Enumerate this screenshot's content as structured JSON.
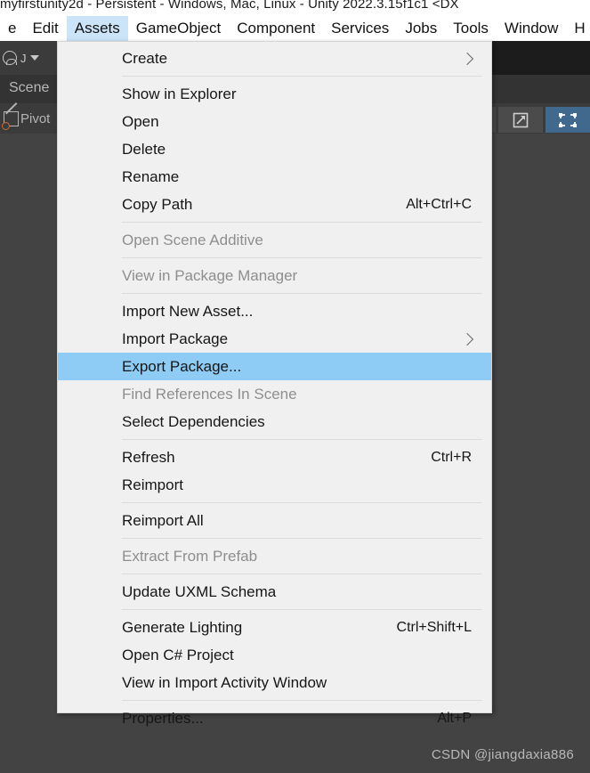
{
  "window": {
    "title": "myfirstunity2d - Persistent - Windows, Mac, Linux - Unity 2022.3.15f1c1 <DX"
  },
  "menubar": {
    "items": [
      {
        "label": "e",
        "active": false
      },
      {
        "label": "Edit",
        "active": false
      },
      {
        "label": "Assets",
        "active": true
      },
      {
        "label": "GameObject",
        "active": false
      },
      {
        "label": "Component",
        "active": false
      },
      {
        "label": "Services",
        "active": false
      },
      {
        "label": "Jobs",
        "active": false
      },
      {
        "label": "Tools",
        "active": false
      },
      {
        "label": "Window",
        "active": false
      },
      {
        "label": "H",
        "active": false
      }
    ]
  },
  "editor": {
    "account_label": "J",
    "scene_tab": "Scene",
    "pivot_label": "Pivot",
    "tools": [
      {
        "name": "rotate-tool",
        "selected": false
      },
      {
        "name": "scale-tool",
        "selected": false
      },
      {
        "name": "rect-transform-tool",
        "selected": true
      }
    ]
  },
  "assets_menu": {
    "entries": [
      {
        "type": "item",
        "label": "Create",
        "shortcut": "",
        "submenu": true,
        "disabled": false,
        "highlight": false
      },
      {
        "type": "separator"
      },
      {
        "type": "item",
        "label": "Show in Explorer",
        "shortcut": "",
        "submenu": false,
        "disabled": false,
        "highlight": false
      },
      {
        "type": "item",
        "label": "Open",
        "shortcut": "",
        "submenu": false,
        "disabled": false,
        "highlight": false
      },
      {
        "type": "item",
        "label": "Delete",
        "shortcut": "",
        "submenu": false,
        "disabled": false,
        "highlight": false
      },
      {
        "type": "item",
        "label": "Rename",
        "shortcut": "",
        "submenu": false,
        "disabled": false,
        "highlight": false
      },
      {
        "type": "item",
        "label": "Copy Path",
        "shortcut": "Alt+Ctrl+C",
        "submenu": false,
        "disabled": false,
        "highlight": false
      },
      {
        "type": "separator"
      },
      {
        "type": "item",
        "label": "Open Scene Additive",
        "shortcut": "",
        "submenu": false,
        "disabled": true,
        "highlight": false
      },
      {
        "type": "separator"
      },
      {
        "type": "item",
        "label": "View in Package Manager",
        "shortcut": "",
        "submenu": false,
        "disabled": true,
        "highlight": false
      },
      {
        "type": "separator"
      },
      {
        "type": "item",
        "label": "Import New Asset...",
        "shortcut": "",
        "submenu": false,
        "disabled": false,
        "highlight": false
      },
      {
        "type": "item",
        "label": "Import Package",
        "shortcut": "",
        "submenu": true,
        "disabled": false,
        "highlight": false
      },
      {
        "type": "item",
        "label": "Export Package...",
        "shortcut": "",
        "submenu": false,
        "disabled": false,
        "highlight": true
      },
      {
        "type": "item",
        "label": "Find References In Scene",
        "shortcut": "",
        "submenu": false,
        "disabled": true,
        "highlight": false
      },
      {
        "type": "item",
        "label": "Select Dependencies",
        "shortcut": "",
        "submenu": false,
        "disabled": false,
        "highlight": false
      },
      {
        "type": "separator"
      },
      {
        "type": "item",
        "label": "Refresh",
        "shortcut": "Ctrl+R",
        "submenu": false,
        "disabled": false,
        "highlight": false
      },
      {
        "type": "item",
        "label": "Reimport",
        "shortcut": "",
        "submenu": false,
        "disabled": false,
        "highlight": false
      },
      {
        "type": "separator"
      },
      {
        "type": "item",
        "label": "Reimport All",
        "shortcut": "",
        "submenu": false,
        "disabled": false,
        "highlight": false
      },
      {
        "type": "separator"
      },
      {
        "type": "item",
        "label": "Extract From Prefab",
        "shortcut": "",
        "submenu": false,
        "disabled": true,
        "highlight": false
      },
      {
        "type": "separator"
      },
      {
        "type": "item",
        "label": "Update UXML Schema",
        "shortcut": "",
        "submenu": false,
        "disabled": false,
        "highlight": false
      },
      {
        "type": "separator"
      },
      {
        "type": "item",
        "label": "Generate Lighting",
        "shortcut": "Ctrl+Shift+L",
        "submenu": false,
        "disabled": false,
        "highlight": false
      },
      {
        "type": "item",
        "label": "Open C# Project",
        "shortcut": "",
        "submenu": false,
        "disabled": false,
        "highlight": false
      },
      {
        "type": "item",
        "label": "View in Import Activity Window",
        "shortcut": "",
        "submenu": false,
        "disabled": false,
        "highlight": false
      },
      {
        "type": "separator"
      },
      {
        "type": "item",
        "label": "Properties...",
        "shortcut": "Alt+P",
        "submenu": false,
        "disabled": false,
        "highlight": false
      }
    ]
  },
  "watermark": {
    "text": "CSDN @jiangdaxia886"
  },
  "colors": {
    "menu_bg": "#f0f0f0",
    "highlight": "#8ecbf5",
    "menubar_active": "#cce4f7",
    "editor_bg": "#434343",
    "tool_selected": "#41698d"
  }
}
